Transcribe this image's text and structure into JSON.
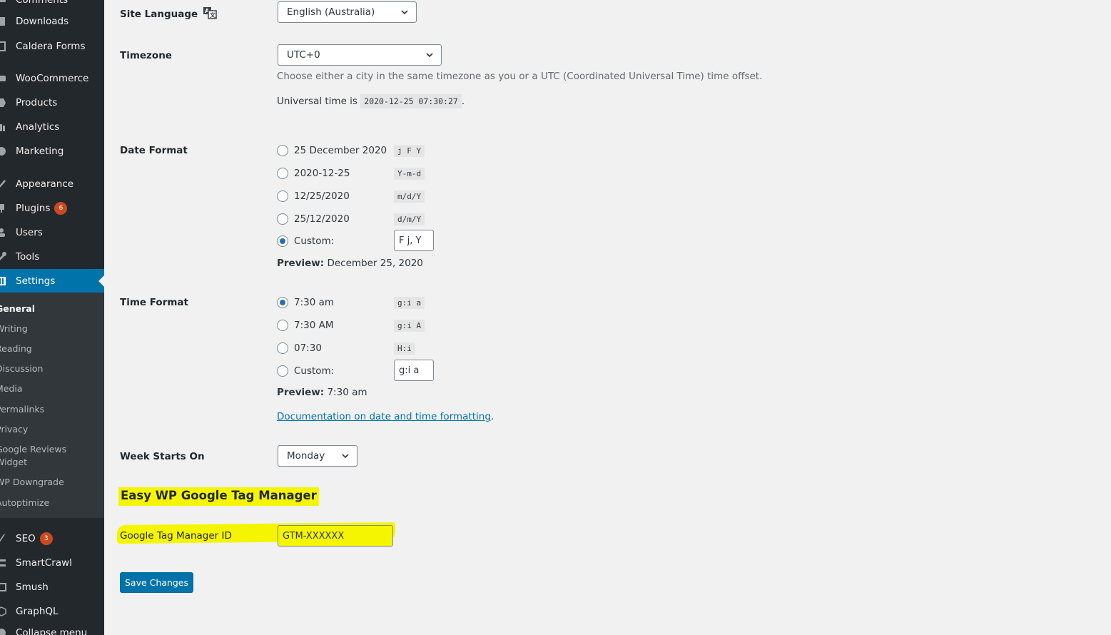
{
  "sidebar": {
    "items": [
      {
        "label": "Comments",
        "icon": "comments-icon"
      },
      {
        "label": "Downloads",
        "icon": "downloads-icon"
      },
      {
        "label": "Caldera Forms",
        "icon": "caldera-forms-icon"
      },
      {
        "label": "WooCommerce",
        "icon": "woocommerce-icon"
      },
      {
        "label": "Products",
        "icon": "products-icon"
      },
      {
        "label": "Analytics",
        "icon": "analytics-icon"
      },
      {
        "label": "Marketing",
        "icon": "marketing-icon"
      },
      {
        "label": "Appearance",
        "icon": "appearance-icon"
      },
      {
        "label": "Plugins",
        "icon": "plugins-icon",
        "badge": "6"
      },
      {
        "label": "Users",
        "icon": "users-icon"
      },
      {
        "label": "Tools",
        "icon": "tools-icon"
      },
      {
        "label": "Settings",
        "icon": "settings-icon",
        "current": true
      },
      {
        "label": "SEO",
        "icon": "seo-icon",
        "badge": "3"
      },
      {
        "label": "SmartCrawl",
        "icon": "smartcrawl-icon"
      },
      {
        "label": "Smush",
        "icon": "smush-icon"
      },
      {
        "label": "GraphQL",
        "icon": "graphql-icon"
      },
      {
        "label": "Collapse menu",
        "icon": "collapse-icon"
      }
    ],
    "submenu": [
      {
        "label": "General",
        "current": true
      },
      {
        "label": "Writing"
      },
      {
        "label": "Reading"
      },
      {
        "label": "Discussion"
      },
      {
        "label": "Media"
      },
      {
        "label": "Permalinks"
      },
      {
        "label": "Privacy"
      },
      {
        "label": "Google Reviews Widget"
      },
      {
        "label": "WP Downgrade"
      },
      {
        "label": "Autoptimize"
      }
    ]
  },
  "site_language": {
    "label": "Site Language",
    "value": "English (Australia)"
  },
  "timezone": {
    "label": "Timezone",
    "value": "UTC+0",
    "description": "Choose either a city in the same timezone as you or a UTC (Coordinated Universal Time) time offset.",
    "universal_prefix": "Universal time is",
    "universal_time": "2020-12-25 07:30:27",
    "universal_suffix": "."
  },
  "date_format": {
    "label": "Date Format",
    "options": [
      {
        "label": "25 December 2020",
        "code": "j F Y",
        "checked": false
      },
      {
        "label": "2020-12-25",
        "code": "Y-m-d",
        "checked": false
      },
      {
        "label": "12/25/2020",
        "code": "m/d/Y",
        "checked": false
      },
      {
        "label": "25/12/2020",
        "code": "d/m/Y",
        "checked": false
      }
    ],
    "custom_label": "Custom:",
    "custom_checked": true,
    "custom_value": "F j, Y",
    "preview_label": "Preview:",
    "preview_value": "December 25, 2020"
  },
  "time_format": {
    "label": "Time Format",
    "options": [
      {
        "label": "7:30 am",
        "code": "g:i a",
        "checked": true
      },
      {
        "label": "7:30 AM",
        "code": "g:i A",
        "checked": false
      },
      {
        "label": "07:30",
        "code": "H:i",
        "checked": false
      }
    ],
    "custom_label": "Custom:",
    "custom_checked": false,
    "custom_value": "g:i a",
    "preview_label": "Preview:",
    "preview_value": "7:30 am",
    "doc_link": "Documentation on date and time formatting",
    "doc_suffix": "."
  },
  "week_starts": {
    "label": "Week Starts On",
    "value": "Monday"
  },
  "gtm": {
    "section_title": "Easy WP Google Tag Manager",
    "id_label": "Google Tag Manager ID",
    "id_value": "GTM-XXXXXX",
    "highlight_color": "#f5f500"
  },
  "save_button": "Save Changes",
  "colors": {
    "accent": "#0073aa",
    "sidebar": "#23282d",
    "submenu": "#32373c",
    "badge": "#ca4a1f"
  }
}
